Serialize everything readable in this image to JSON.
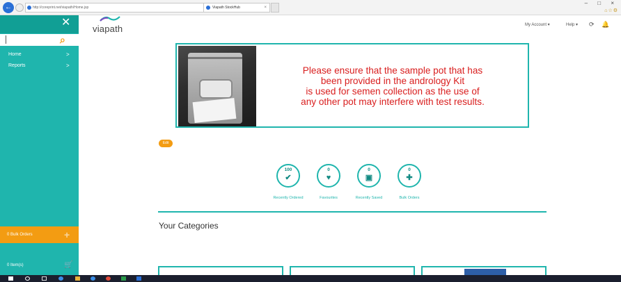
{
  "browser": {
    "url": "http://coreprint.net/viapath/Home.jsp",
    "address_tools": "⌕ ▾ ↻",
    "tab_title": "Viapath StockHub",
    "tab_close": "×",
    "window_controls": "– □ ×",
    "right_icons": "⌂☆⚙"
  },
  "sidebar": {
    "close_glyph": "✕",
    "search_glyph": "⌕",
    "items": [
      {
        "label": "Home",
        "chevron": ">"
      },
      {
        "label": "Reports",
        "chevron": ">"
      }
    ],
    "bulk_orders": {
      "label": "0 Bulk Orders",
      "glyph": "+"
    },
    "items_in_cart": {
      "label": "0 Item(s)",
      "glyph": "🛒"
    }
  },
  "header": {
    "logo": "viapath",
    "my_account": "My Account ▾",
    "help": "Help ▾",
    "refresh_glyph": "⟳",
    "notify_glyph": "🔔"
  },
  "banner": {
    "lines": [
      "Please ensure that the sample pot that has",
      "been provided in the andrology Kit",
      "is used for semen collection as the use of",
      "any other pot may interfere with  test results."
    ]
  },
  "edit_label": "Edit",
  "tiles": [
    {
      "count": "100",
      "glyph": "✔",
      "label": "Recently Ordered"
    },
    {
      "count": "0",
      "glyph": "♥",
      "label": "Favourites"
    },
    {
      "count": "0",
      "glyph": "▣",
      "label": "Recently Saved"
    },
    {
      "count": "0",
      "glyph": "✚",
      "label": "Bulk Orders"
    }
  ],
  "categories_title": "Your Categories",
  "colors": {
    "accent": "#1fb5ad",
    "orange": "#f39c12",
    "banner_text": "#d91e1e"
  }
}
